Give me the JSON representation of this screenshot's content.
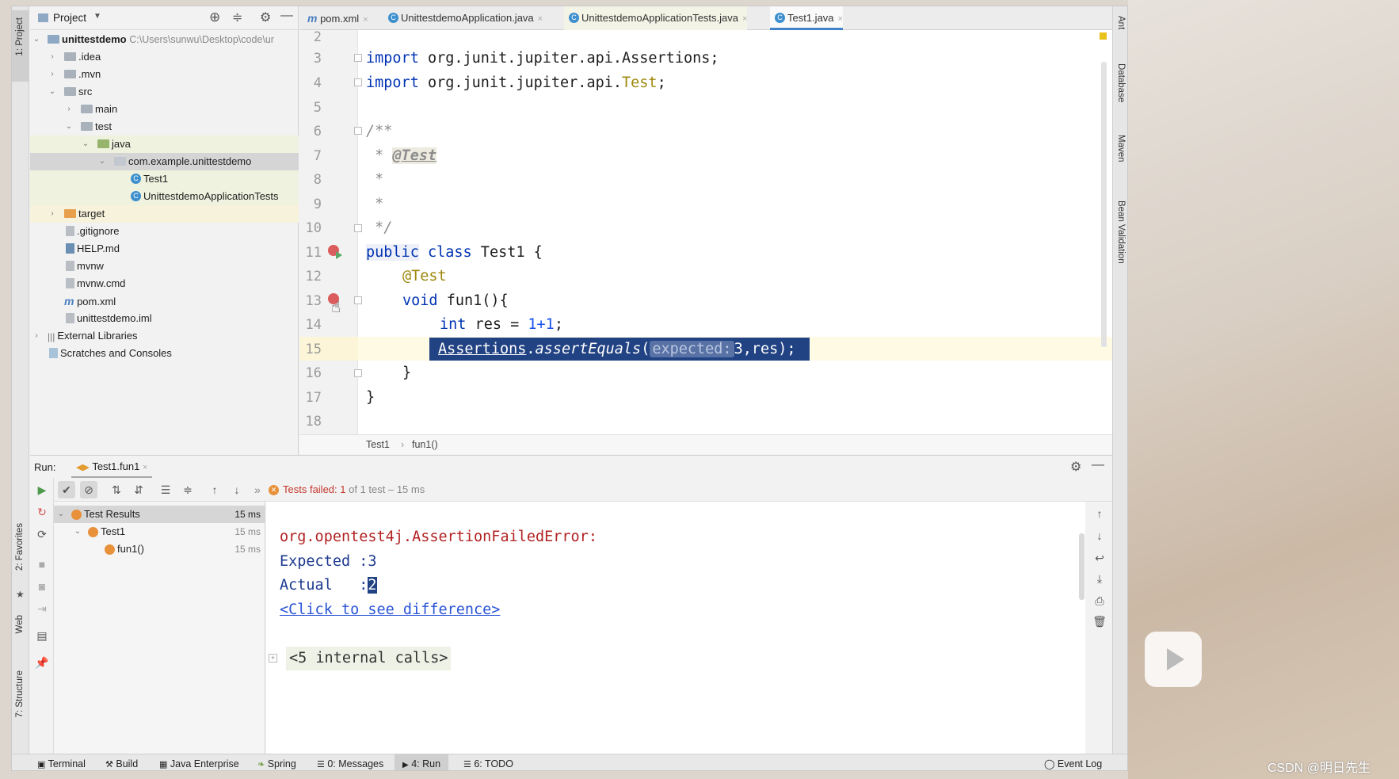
{
  "project_panel": {
    "title": "Project",
    "root_name": "unittestdemo",
    "root_path": "C:\\Users\\sunwu\\Desktop\\code\\ur",
    "tree": [
      {
        "label": ".idea"
      },
      {
        "label": ".mvn"
      },
      {
        "label": "src"
      },
      {
        "label": "main"
      },
      {
        "label": "test"
      },
      {
        "label": "java"
      },
      {
        "label": "com.example.unittestdemo"
      },
      {
        "label": "Test1"
      },
      {
        "label": "UnittestdemoApplicationTests"
      },
      {
        "label": "target"
      },
      {
        "label": ".gitignore"
      },
      {
        "label": "HELP.md"
      },
      {
        "label": "mvnw"
      },
      {
        "label": "mvnw.cmd"
      },
      {
        "label": "pom.xml"
      },
      {
        "label": "unittestdemo.iml"
      },
      {
        "label": "External Libraries"
      },
      {
        "label": "Scratches and Consoles"
      }
    ]
  },
  "left_strip": {
    "project": "1: Project",
    "favorites": "2: Favorites",
    "web": "Web",
    "structure": "7: Structure"
  },
  "right_strip": {
    "ant": "Ant",
    "database": "Database",
    "maven": "Maven",
    "bean": "Bean Validation"
  },
  "editor_tabs": [
    {
      "label": "pom.xml"
    },
    {
      "label": "UnittestdemoApplication.java"
    },
    {
      "label": "UnittestdemoApplicationTests.java"
    },
    {
      "label": "Test1.java"
    }
  ],
  "code": {
    "line_numbers": [
      "2",
      "3",
      "4",
      "5",
      "6",
      "7",
      "8",
      "9",
      "10",
      "11",
      "12",
      "13",
      "14",
      "15",
      "16",
      "17",
      "18"
    ],
    "l3_kw": "import",
    "l3_rest": " org.junit.jupiter.api.Assertions;",
    "l4_kw": "import",
    "l4_rest": " org.junit.jupiter.api.",
    "l4_cls": "Test",
    "l4_end": ";",
    "l6": "/**",
    "l7_star": " * ",
    "l7_tag": "@Test",
    "l8": " *",
    "l9": " *",
    "l10": " */",
    "l11_kw1": "public",
    "l11_kw2": "class",
    "l11_rest": " Test1 {",
    "l12": "@Test",
    "l13_kw": "void",
    "l13_rest": " fun1(){",
    "l14_kw": "int",
    "l14_a": " res = ",
    "l14_n": "1+1",
    "l14_b": ";",
    "l15_a": "Assertions",
    "l15_b": ".",
    "l15_c": "assertEquals",
    "l15_d": "(",
    "l15_hint": "expected:",
    "l15_e": "3,res);",
    "l16": "}",
    "l17": "}"
  },
  "breadcrumb": {
    "class": "Test1",
    "sep": "›",
    "method": "fun1()"
  },
  "run_panel": {
    "label": "Run:",
    "tab": "Test1.fun1",
    "status_prefix": "Tests failed: ",
    "status_count": "1",
    "status_suffix": " of 1 test – 15 ms",
    "tree": [
      {
        "label": "Test Results",
        "time": "15 ms"
      },
      {
        "label": "Test1",
        "time": "15 ms"
      },
      {
        "label": "fun1()",
        "time": "15 ms"
      }
    ],
    "output": {
      "line1": "org.opentest4j.AssertionFailedError:",
      "line2": "Expected :3",
      "line3_prefix": "Actual   :",
      "line3_value": "2",
      "link": "<Click to see difference>",
      "internal": "<5 internal calls>"
    }
  },
  "bottom_bar": {
    "terminal": "Terminal",
    "build": "Build",
    "java_ent": "Java Enterprise",
    "spring": "Spring",
    "messages": "0: Messages",
    "run": "4: Run",
    "todo": "6: TODO",
    "event_log": "Event Log"
  },
  "watermark": "CSDN @明日先生"
}
